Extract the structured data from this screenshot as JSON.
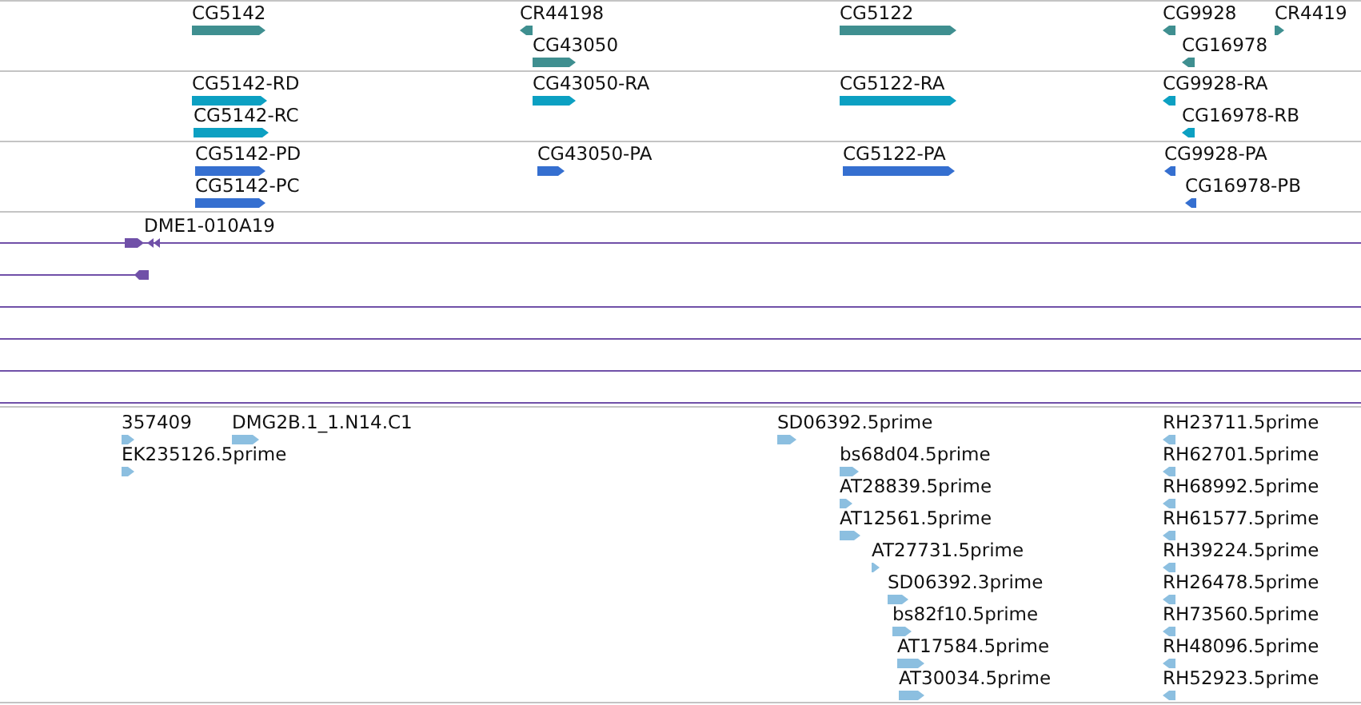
{
  "tracks": [
    {
      "kind": "gene",
      "features": [
        {
          "label": "CG5142",
          "reverse": false
        },
        {
          "label": "CR44198",
          "reverse": true
        },
        {
          "label": "CG43050",
          "reverse": false
        },
        {
          "label": "CG5122",
          "reverse": false
        },
        {
          "label": "CG9928",
          "reverse": true
        },
        {
          "label": "CR4419",
          "reverse": false
        },
        {
          "label": "CG16978",
          "reverse": true
        }
      ]
    },
    {
      "kind": "transcript",
      "features": [
        {
          "label": "CG5142-RD",
          "reverse": false
        },
        {
          "label": "CG5142-RC",
          "reverse": false
        },
        {
          "label": "CG43050-RA",
          "reverse": false
        },
        {
          "label": "CG5122-RA",
          "reverse": false
        },
        {
          "label": "CG9928-RA",
          "reverse": true
        },
        {
          "label": "CG16978-RB",
          "reverse": true
        }
      ]
    },
    {
      "kind": "protein",
      "features": [
        {
          "label": "CG5142-PD",
          "reverse": false
        },
        {
          "label": "CG5142-PC",
          "reverse": false
        },
        {
          "label": "CG43050-PA",
          "reverse": false
        },
        {
          "label": "CG5122-PA",
          "reverse": false
        },
        {
          "label": "CG9928-PA",
          "reverse": true
        },
        {
          "label": "CG16978-PB",
          "reverse": true
        }
      ]
    },
    {
      "kind": "clone",
      "features": [
        {
          "label": "DME1-010A19",
          "reverse": false
        }
      ]
    },
    {
      "kind": "est",
      "features": [
        {
          "label": "357409",
          "reverse": false
        },
        {
          "label": "DMG2B.1_1.N14.C1",
          "reverse": false
        },
        {
          "label": "EK235126.5prime",
          "reverse": false
        },
        {
          "label": "SD06392.5prime",
          "reverse": false
        },
        {
          "label": "bs68d04.5prime",
          "reverse": false
        },
        {
          "label": "AT28839.5prime",
          "reverse": false
        },
        {
          "label": "AT12561.5prime",
          "reverse": false
        },
        {
          "label": "AT27731.5prime",
          "reverse": false
        },
        {
          "label": "SD06392.3prime",
          "reverse": false
        },
        {
          "label": "bs82f10.5prime",
          "reverse": false
        },
        {
          "label": "AT17584.5prime",
          "reverse": false
        },
        {
          "label": "AT30034.5prime",
          "reverse": false
        },
        {
          "label": "RH23711.5prime",
          "reverse": true
        },
        {
          "label": "RH62701.5prime",
          "reverse": true
        },
        {
          "label": "RH68992.5prime",
          "reverse": true
        },
        {
          "label": "RH61577.5prime",
          "reverse": true
        },
        {
          "label": "RH39224.5prime",
          "reverse": true
        },
        {
          "label": "RH26478.5prime",
          "reverse": true
        },
        {
          "label": "RH73560.5prime",
          "reverse": true
        },
        {
          "label": "RH48096.5prime",
          "reverse": true
        },
        {
          "label": "RH52923.5prime",
          "reverse": true
        }
      ]
    }
  ]
}
